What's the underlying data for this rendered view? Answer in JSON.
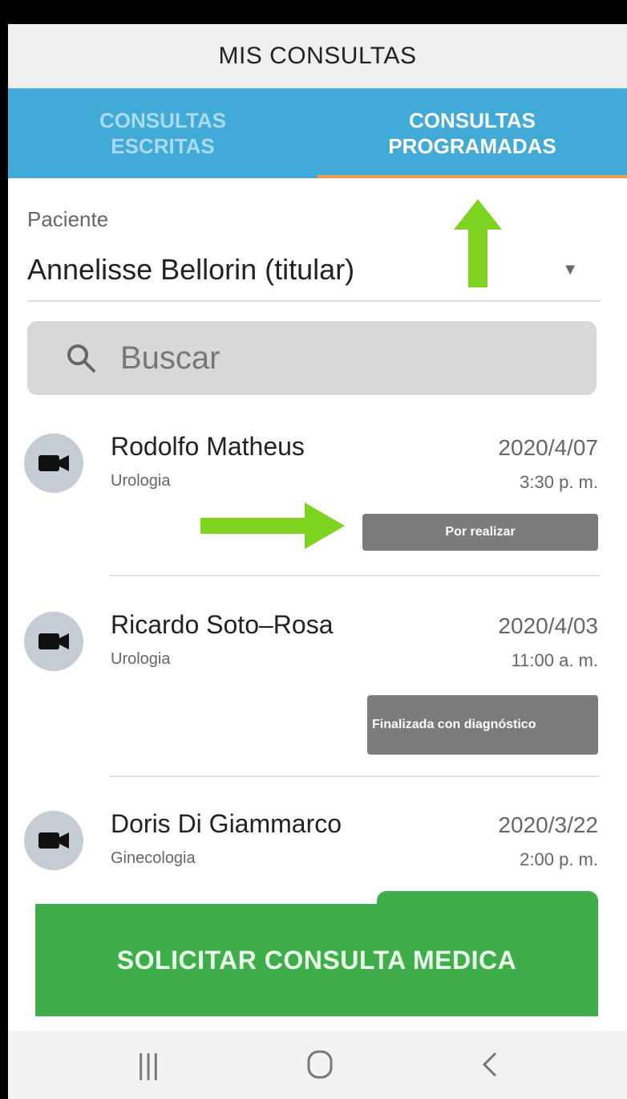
{
  "header": {
    "title": "MIS CONSULTAS"
  },
  "tabs": [
    {
      "label_line1": "CONSULTAS",
      "label_line2": "ESCRITAS",
      "active": false
    },
    {
      "label_line1": "CONSULTAS",
      "label_line2": "PROGRAMADAS",
      "active": true
    }
  ],
  "patient": {
    "label": "Paciente",
    "value": "Annelisse Bellorin (titular)"
  },
  "search": {
    "placeholder": "Buscar"
  },
  "appointments": [
    {
      "doctor": "Rodolfo Matheus",
      "specialty": "Urologia",
      "date": "2020/4/07",
      "time": "3:30 p. m.",
      "status": "Por realizar"
    },
    {
      "doctor": "Ricardo Soto–Rosa",
      "specialty": "Urologia",
      "date": "2020/4/03",
      "time": "11:00 a. m.",
      "status": "Finalizada con diagnóstico"
    },
    {
      "doctor": "Doris Di Giammarco",
      "specialty": "Ginecologia",
      "date": "2020/3/22",
      "time": "2:00 p. m."
    }
  ],
  "cta": {
    "label": "SOLICITAR CONSULTA MEDICA"
  },
  "colors": {
    "tab_bar": "#42aad6",
    "active_underline": "#e8a058",
    "cta": "#3fae4a",
    "annotation_arrow": "#7ed321",
    "badge": "#7b7b7b"
  },
  "icons": [
    "videocam-icon",
    "search-icon",
    "dropdown-caret-icon",
    "recents-icon",
    "home-icon",
    "back-icon"
  ]
}
